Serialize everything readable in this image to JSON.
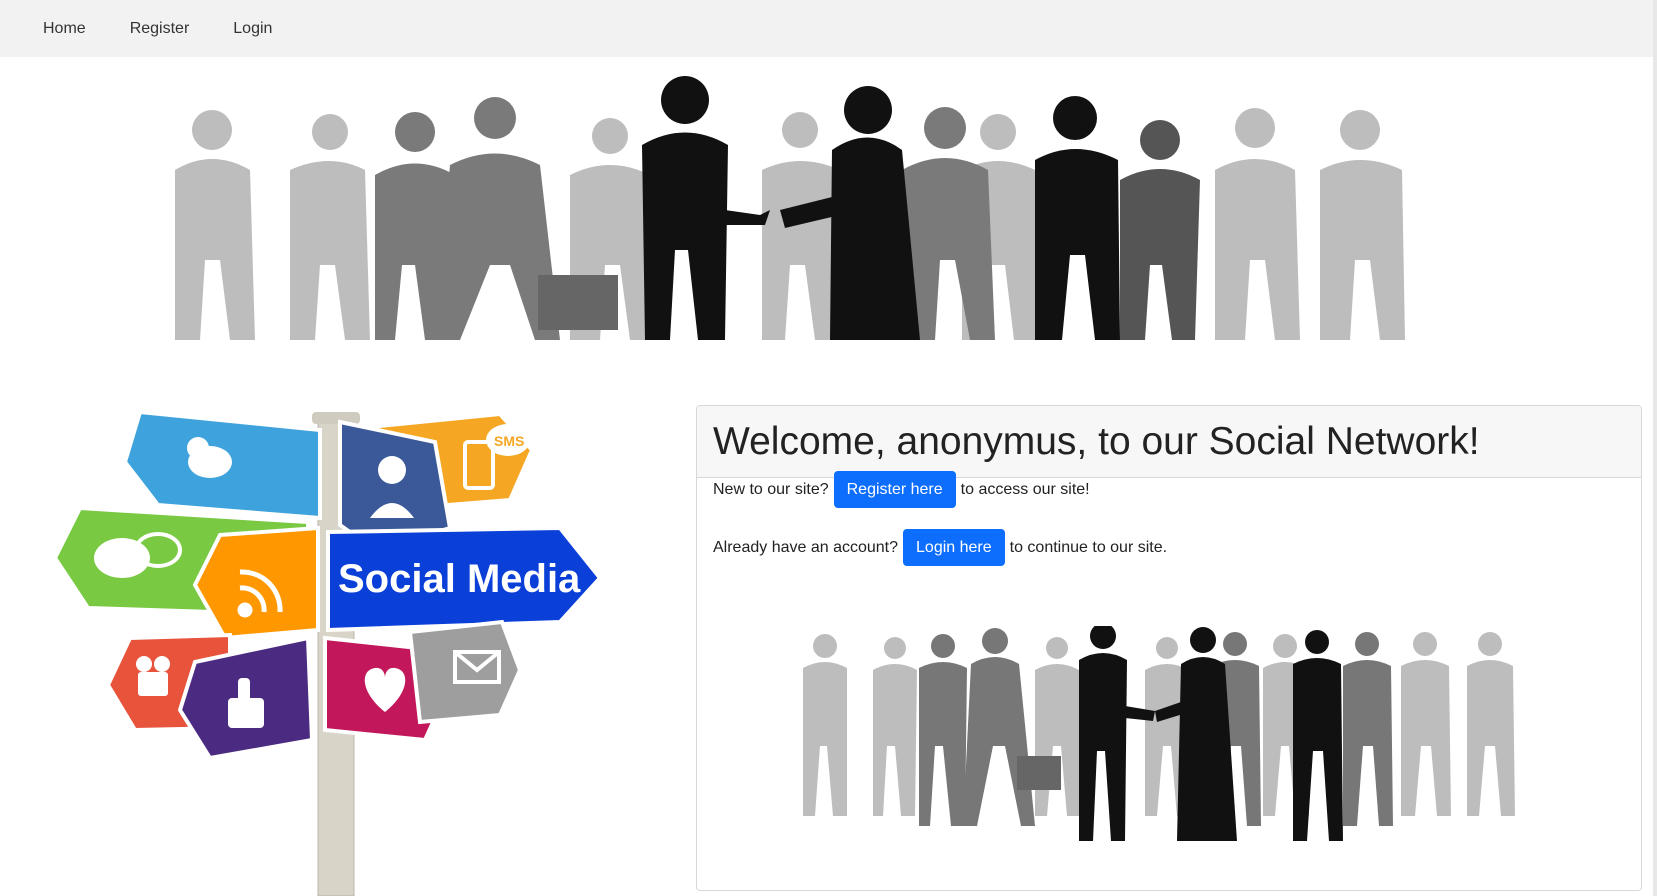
{
  "nav": {
    "items": [
      {
        "label": "Home"
      },
      {
        "label": "Register"
      },
      {
        "label": "Login"
      }
    ]
  },
  "welcome": {
    "title": "Welcome, anonymus, to our Social Network!",
    "new_prefix": "New to our site?",
    "register_button": "Register here",
    "new_suffix": "to access our site!",
    "existing_prefix": "Already have an account?",
    "login_button": "Login here",
    "existing_suffix": "to continue to our site."
  },
  "signpost": {
    "social_media_label": "Social Media",
    "sms_label": "SMS"
  },
  "colors": {
    "accent": "#0d6efd",
    "navbar_bg": "#f2f2f2"
  }
}
